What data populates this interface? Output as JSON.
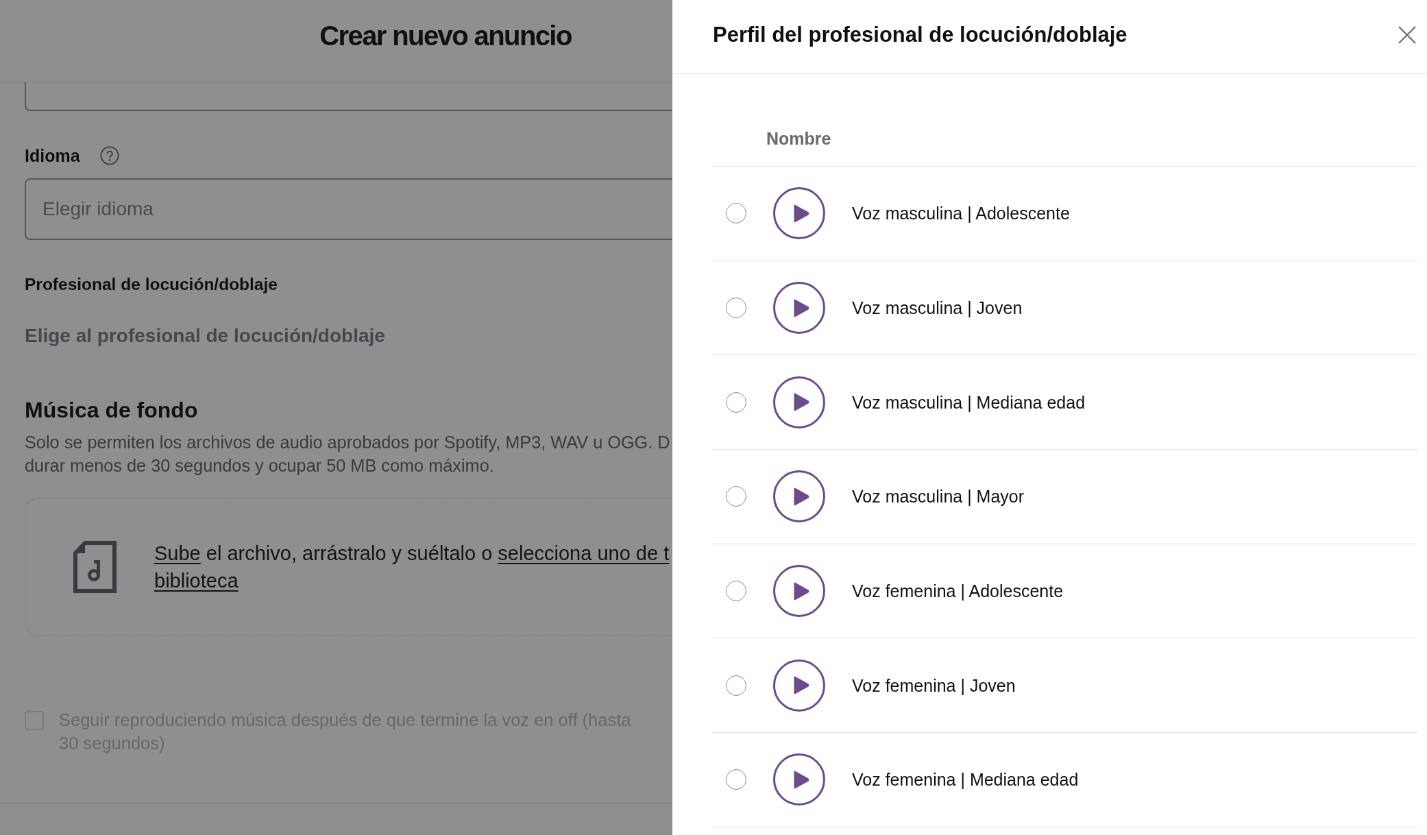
{
  "main": {
    "title": "Crear nuevo anuncio",
    "language": {
      "label": "Idioma",
      "placeholder": "Elegir idioma"
    },
    "voice_talent": {
      "label": "Profesional de locución/doblaje",
      "prompt": "Elige al profesional de locución/doblaje"
    },
    "background_music": {
      "title": "Música de fondo",
      "description": "Solo se permiten los archivos de audio aprobados por Spotify, MP3, WAV u OGG. D\ndurar menos de 30 segundos y ocupar 50 MB como máximo.",
      "upload": {
        "lines": [
          [
            {
              "kind": "link",
              "text": "Sube"
            },
            {
              "kind": "text",
              "text": " el archivo, arrástralo y suéltalo o "
            },
            {
              "kind": "link",
              "text": "selecciona uno de t"
            }
          ],
          [
            {
              "kind": "link",
              "text": "biblioteca"
            }
          ]
        ]
      },
      "keep_playing": {
        "label": "Seguir reproduciendo música después de que termine la voz en off (hasta 30 segundos)",
        "checked": false,
        "disabled": true
      }
    }
  },
  "drawer": {
    "title": "Perfil del profesional de locución/doblaje",
    "columns": [
      "Nombre"
    ],
    "rows": [
      {
        "name": "Voz masculina | Adolescente",
        "selected": false
      },
      {
        "name": "Voz masculina | Joven",
        "selected": false
      },
      {
        "name": "Voz masculina | Mediana edad",
        "selected": false
      },
      {
        "name": "Voz masculina | Mayor",
        "selected": false
      },
      {
        "name": "Voz femenina | Adolescente",
        "selected": false
      },
      {
        "name": "Voz femenina | Joven",
        "selected": false
      },
      {
        "name": "Voz femenina | Mediana edad",
        "selected": false
      }
    ]
  }
}
